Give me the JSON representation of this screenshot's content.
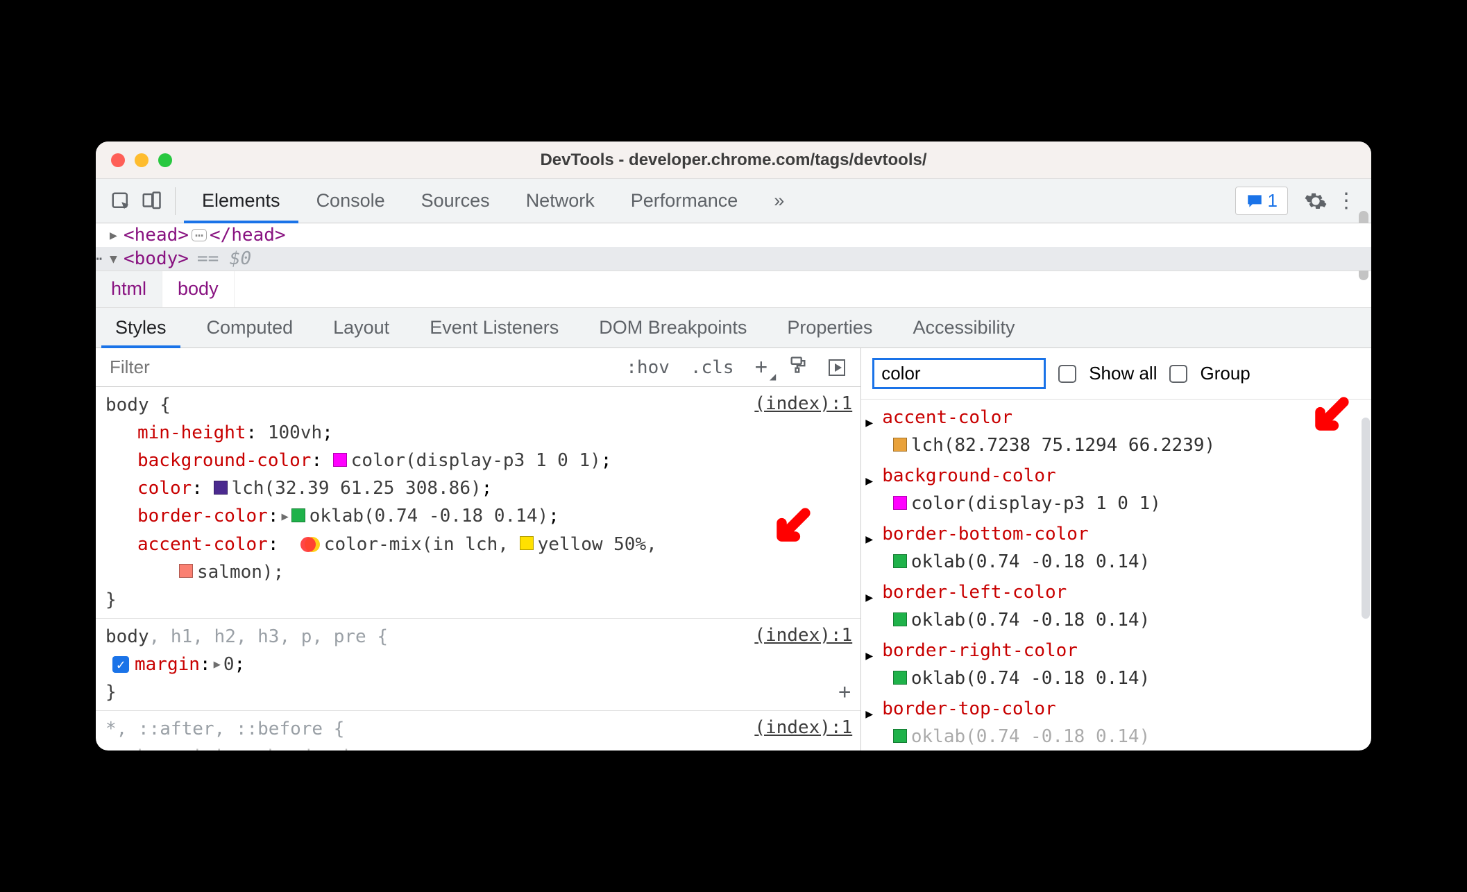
{
  "titlebar": {
    "title": "DevTools - developer.chrome.com/tags/devtools/"
  },
  "toolbar": {
    "tabs": [
      "Elements",
      "Console",
      "Sources",
      "Network",
      "Performance"
    ],
    "overflow": "»",
    "issue_count": "1"
  },
  "dom": {
    "head_open": "<head>",
    "head_close": "</head>",
    "body_tag": "<body>",
    "eq": "== $0"
  },
  "breadcrumb": [
    "html",
    "body"
  ],
  "subtabs": [
    "Styles",
    "Computed",
    "Layout",
    "Event Listeners",
    "DOM Breakpoints",
    "Properties",
    "Accessibility"
  ],
  "filter": {
    "placeholder": "Filter",
    "hov": ":hov",
    "cls": ".cls"
  },
  "rules": [
    {
      "selector": "body {",
      "src": "(index):1",
      "decls": [
        {
          "prop": "min-height",
          "pre": "",
          "val": "100vh",
          "swatch": null
        },
        {
          "prop": "background-color",
          "pre": "",
          "val": "color(display-p3 1 0 1)",
          "swatch": "#f0f"
        },
        {
          "prop": "color",
          "pre": "",
          "val": "lch(32.39 61.25 308.86)",
          "swatch": "#4b2a8f"
        },
        {
          "prop": "border-color",
          "pre": "▶ ",
          "val": "oklab(0.74 -0.18 0.14)",
          "swatch": "#1fb24a"
        },
        {
          "prop": "accent-color",
          "mix": true,
          "val": "color-mix(in lch, ",
          "swatch": null,
          "tail_sw": "#ffe100",
          "tail": "yellow 50%,",
          "cont_sw": "#fa8072",
          "cont": "salmon);"
        }
      ],
      "close": "}"
    },
    {
      "selector_rich": {
        "main": "body",
        "rest": ", h1, h2, h3, p, pre {"
      },
      "src": "(index):1",
      "decls": [
        {
          "prop": "margin",
          "pre": "▶ ",
          "val": "0",
          "checked": true
        }
      ],
      "close": "}",
      "add": true
    },
    {
      "selector": "*, ::after, ::before {",
      "src": "(index):1",
      "decls_fade": "box-sizing: border-box;"
    }
  ],
  "computed": {
    "filter_value": "color",
    "show_all": "Show all",
    "group": "Group",
    "items": [
      {
        "name": "accent-color",
        "sw": "#e9a23b",
        "val": "lch(82.7238 75.1294 66.2239)"
      },
      {
        "name": "background-color",
        "sw": "#f0f",
        "val": "color(display-p3 1 0 1)"
      },
      {
        "name": "border-bottom-color",
        "sw": "#1fb24a",
        "val": "oklab(0.74 -0.18 0.14)"
      },
      {
        "name": "border-left-color",
        "sw": "#1fb24a",
        "val": "oklab(0.74 -0.18 0.14)"
      },
      {
        "name": "border-right-color",
        "sw": "#1fb24a",
        "val": "oklab(0.74 -0.18 0.14)"
      },
      {
        "name": "border-top-color",
        "sw": "#1fb24a",
        "val": "oklab(0.74 -0.18 0.14)"
      }
    ]
  }
}
